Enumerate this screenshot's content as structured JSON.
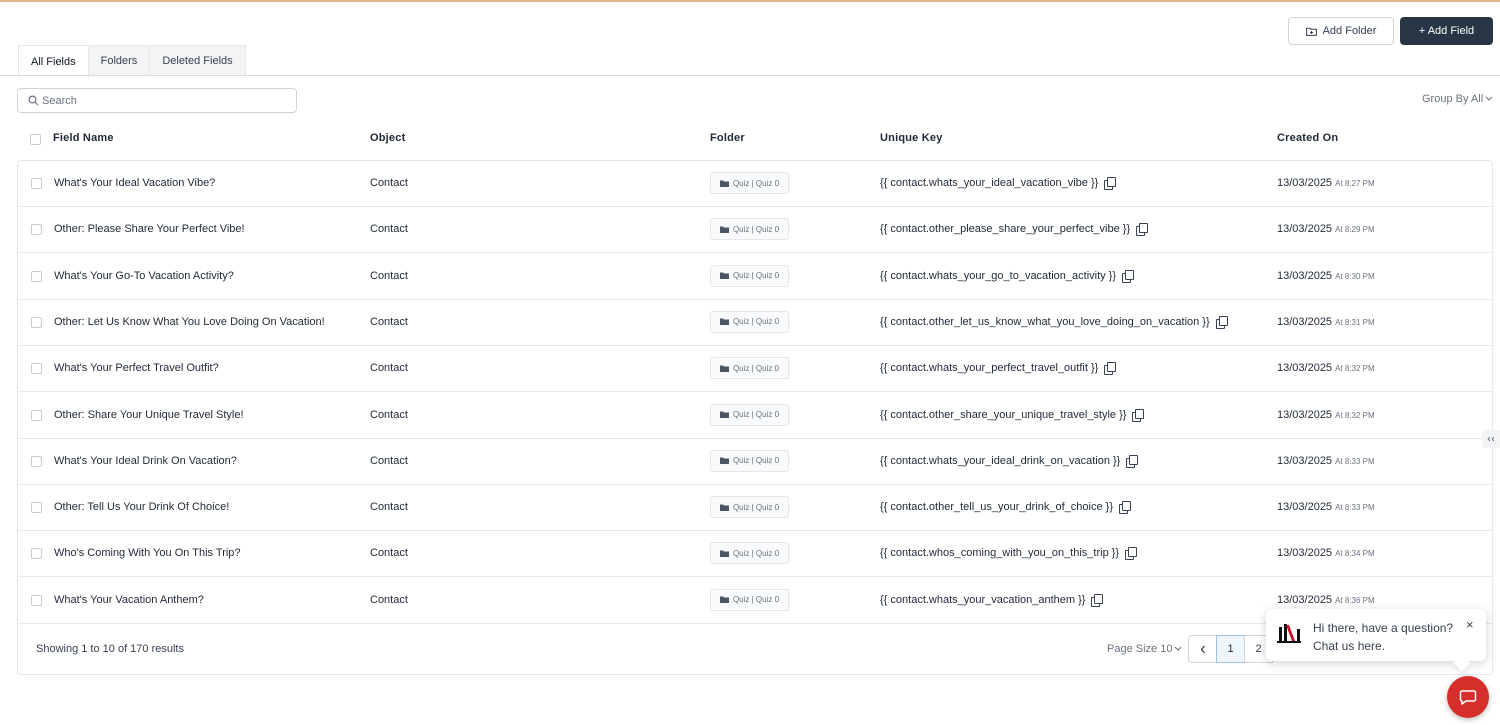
{
  "toolbar": {
    "add_folder_label": "Add Folder",
    "add_field_label": "+ Add Field"
  },
  "tabs": [
    {
      "label": "All Fields",
      "active": true
    },
    {
      "label": "Folders",
      "active": false
    },
    {
      "label": "Deleted Fields",
      "active": false
    }
  ],
  "search": {
    "placeholder": "Search"
  },
  "group_by": {
    "label": "Group By All"
  },
  "table": {
    "headers": {
      "field_name": "Field Name",
      "object": "Object",
      "folder": "Folder",
      "unique_key": "Unique Key",
      "created_on": "Created On"
    },
    "rows": [
      {
        "name": "What's Your Ideal Vacation Vibe?",
        "object": "Contact",
        "folder": "Quiz | Quiz 0",
        "key": "{{ contact.whats_your_ideal_vacation_vibe }}",
        "date": "13/03/2025",
        "time": "At 8:27 PM"
      },
      {
        "name": "Other: Please Share Your Perfect Vibe!",
        "object": "Contact",
        "folder": "Quiz | Quiz 0",
        "key": "{{ contact.other_please_share_your_perfect_vibe }}",
        "date": "13/03/2025",
        "time": "At 8:29 PM"
      },
      {
        "name": "What's Your Go-To Vacation Activity?",
        "object": "Contact",
        "folder": "Quiz | Quiz 0",
        "key": "{{ contact.whats_your_go_to_vacation_activity }}",
        "date": "13/03/2025",
        "time": "At 8:30 PM"
      },
      {
        "name": "Other: Let Us Know What You Love Doing On Vacation!",
        "object": "Contact",
        "folder": "Quiz | Quiz 0",
        "key": "{{ contact.other_let_us_know_what_you_love_doing_on_vacation }}",
        "date": "13/03/2025",
        "time": "At 8:31 PM"
      },
      {
        "name": "What's Your Perfect Travel Outfit?",
        "object": "Contact",
        "folder": "Quiz | Quiz 0",
        "key": "{{ contact.whats_your_perfect_travel_outfit }}",
        "date": "13/03/2025",
        "time": "At 8:32 PM"
      },
      {
        "name": "Other: Share Your Unique Travel Style!",
        "object": "Contact",
        "folder": "Quiz | Quiz 0",
        "key": "{{ contact.other_share_your_unique_travel_style }}",
        "date": "13/03/2025",
        "time": "At 8:32 PM"
      },
      {
        "name": "What's Your Ideal Drink On Vacation?",
        "object": "Contact",
        "folder": "Quiz | Quiz 0",
        "key": "{{ contact.whats_your_ideal_drink_on_vacation }}",
        "date": "13/03/2025",
        "time": "At 8:33 PM"
      },
      {
        "name": "Other: Tell Us Your Drink Of Choice!",
        "object": "Contact",
        "folder": "Quiz | Quiz 0",
        "key": "{{ contact.other_tell_us_your_drink_of_choice }}",
        "date": "13/03/2025",
        "time": "At 8:33 PM"
      },
      {
        "name": "Who's Coming With You On This Trip?",
        "object": "Contact",
        "folder": "Quiz | Quiz 0",
        "key": "{{ contact.whos_coming_with_you_on_this_trip }}",
        "date": "13/03/2025",
        "time": "At 8:34 PM"
      },
      {
        "name": "What's Your Vacation Anthem?",
        "object": "Contact",
        "folder": "Quiz | Quiz 0",
        "key": "{{ contact.whats_your_vacation_anthem }}",
        "date": "13/03/2025",
        "time": "At 8:36 PM"
      }
    ]
  },
  "footer": {
    "showing": "Showing 1 to 10 of 170 results",
    "page_size": "Page Size 10",
    "pages": [
      "1",
      "2"
    ],
    "current_page": "1"
  },
  "chat": {
    "message": "Hi there, have a question? Chat us here.",
    "close": "×"
  },
  "colors": {
    "primary": "#273544",
    "chat": "#d62e2a",
    "active_page": "#eef5fb"
  },
  "icons": [
    "folder-plus-icon",
    "search-icon",
    "chevron-down-icon",
    "folder-icon",
    "copy-icon",
    "chevron-left-icon",
    "close-icon",
    "chat-bubble-icon"
  ]
}
